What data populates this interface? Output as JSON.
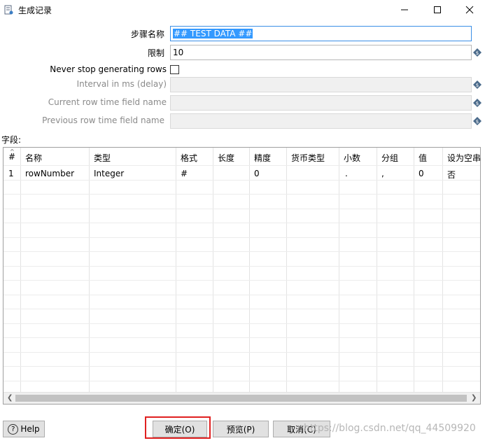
{
  "window": {
    "title": "生成记录",
    "icon": "document-icon"
  },
  "form": {
    "step_name": {
      "label": "步骤名称",
      "value": "## TEST DATA ##"
    },
    "limit": {
      "label": "限制",
      "value": "10"
    },
    "never_stop": {
      "label": "Never stop generating rows",
      "checked": false
    },
    "interval": {
      "label": "Interval in ms (delay)",
      "value": ""
    },
    "current_time_field": {
      "label": "Current row time field name",
      "value": ""
    },
    "previous_time_field": {
      "label": "Previous row time field name",
      "value": ""
    }
  },
  "fields_label": "字段:",
  "table": {
    "columns": [
      "#",
      "名称",
      "类型",
      "格式",
      "长度",
      "精度",
      "货币类型",
      "小数",
      "分组",
      "值",
      "设为空串"
    ],
    "rows": [
      [
        "1",
        "rowNumber",
        "Integer",
        "#",
        "",
        "0",
        "",
        ".",
        ",",
        "0",
        "否"
      ]
    ]
  },
  "buttons": {
    "help": "Help",
    "ok": "确定(O)",
    "preview": "预览(P)",
    "cancel": "取消(C)"
  },
  "watermark": "https://blog.csdn.net/qq_44509920",
  "colors": {
    "selection": "#3399ff",
    "highlight_border": "#e02020",
    "variable_icon": "#4a6a8a"
  }
}
